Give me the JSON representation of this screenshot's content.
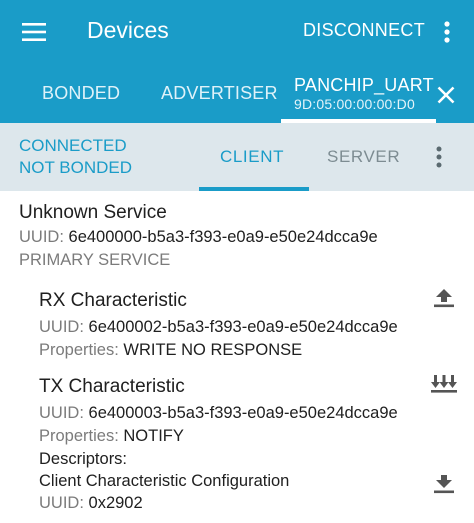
{
  "app_bar": {
    "title": "Devices",
    "disconnect_label": "DISCONNECT"
  },
  "device_tabs": {
    "bonded_label": "BONDED",
    "advertiser_label": "ADVERTISER",
    "active_device_name": "PANCHIP_UART",
    "active_device_address": "9D:05:00:00:00:D0"
  },
  "connection": {
    "status_line1": "CONNECTED",
    "status_line2": "NOT BONDED",
    "client_tab": "CLIENT",
    "server_tab": "SERVER"
  },
  "service": {
    "name": "Unknown Service",
    "uuid_label": "UUID:",
    "uuid": "6e400000-b5a3-f393-e0a9-e50e24dcca9e",
    "type": "PRIMARY SERVICE"
  },
  "characteristics": [
    {
      "name": "RX Characteristic",
      "uuid_label": "UUID:",
      "uuid": "6e400002-b5a3-f393-e0a9-e50e24dcca9e",
      "properties_label": "Properties:",
      "properties": "WRITE NO RESPONSE"
    },
    {
      "name": "TX Characteristic",
      "uuid_label": "UUID:",
      "uuid": "6e400003-b5a3-f393-e0a9-e50e24dcca9e",
      "properties_label": "Properties:",
      "properties": "NOTIFY",
      "descriptors_label": "Descriptors:",
      "descriptor": {
        "name": "Client Characteristic Configuration",
        "uuid_label": "UUID:",
        "uuid": "0x2902"
      }
    }
  ],
  "icons": {
    "menu": "hamburger-menu-icon",
    "overflow": "more-vert-icon",
    "close": "close-icon",
    "write": "upload-arrow-icon",
    "notify": "triple-down-arrow-icon",
    "read": "download-arrow-icon"
  },
  "colors": {
    "primary": "#1a9cc8",
    "tab_bar_bg": "#dde7ec",
    "secondary_text": "#7b7b7b",
    "action_icon": "#555555"
  }
}
